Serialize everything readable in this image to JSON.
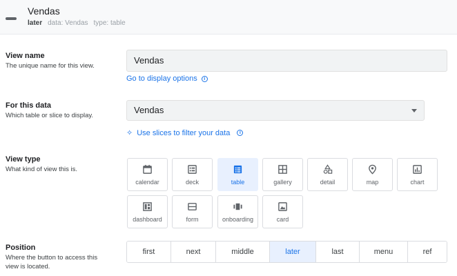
{
  "header": {
    "title": "Vendas",
    "position_value": "later",
    "data_label": "data:",
    "data_value": "Vendas",
    "type_label": "type:",
    "type_value": "table"
  },
  "view_name": {
    "title": "View name",
    "description": "The unique name for this view.",
    "value": "Vendas",
    "link": "Go to display options"
  },
  "for_this_data": {
    "title": "For this data",
    "description": "Which table or slice to display.",
    "value": "Vendas",
    "link": "Use slices to filter your data"
  },
  "view_type": {
    "title": "View type",
    "description": "What kind of view this is.",
    "selected": "table",
    "options": [
      {
        "label": "calendar",
        "icon": "calendar-icon"
      },
      {
        "label": "deck",
        "icon": "deck-icon"
      },
      {
        "label": "table",
        "icon": "table-icon"
      },
      {
        "label": "gallery",
        "icon": "gallery-icon"
      },
      {
        "label": "detail",
        "icon": "detail-icon"
      },
      {
        "label": "map",
        "icon": "map-pin-icon"
      },
      {
        "label": "chart",
        "icon": "chart-icon"
      },
      {
        "label": "dashboard",
        "icon": "dashboard-icon"
      },
      {
        "label": "form",
        "icon": "form-icon"
      },
      {
        "label": "onboarding",
        "icon": "onboarding-icon"
      },
      {
        "label": "card",
        "icon": "card-icon"
      }
    ]
  },
  "position": {
    "title": "Position",
    "description_line1": "Where the button to access this",
    "description_line2": "view is located.",
    "selected": "later",
    "options": [
      "first",
      "next",
      "middle",
      "later",
      "last",
      "menu",
      "ref"
    ]
  },
  "colors": {
    "accent": "#1a73e8",
    "selected_bg": "#e8f0fe",
    "input_bg": "#f1f3f4",
    "header_bg": "#f8f9fa"
  }
}
